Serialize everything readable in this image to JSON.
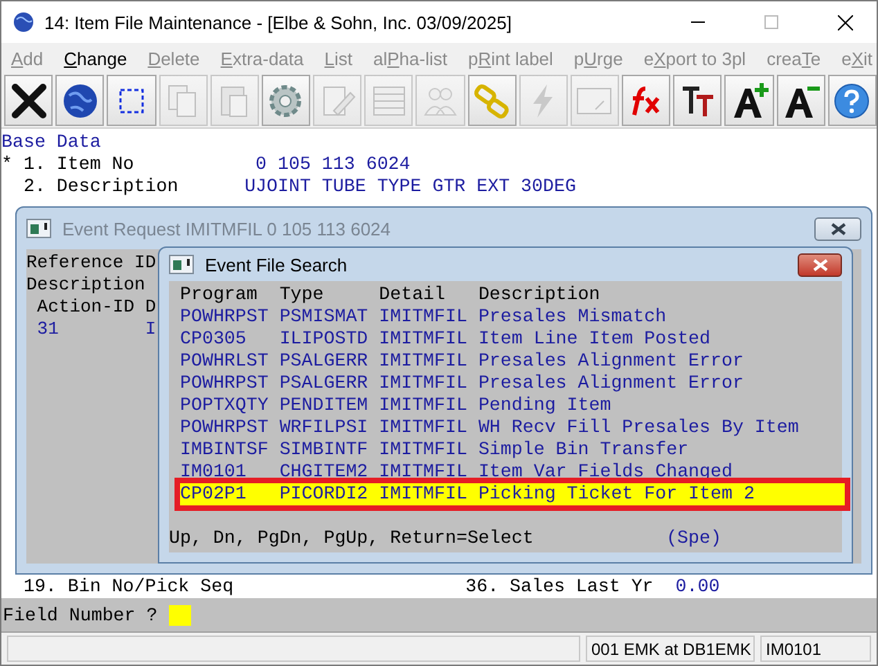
{
  "window": {
    "title": "14: Item File Maintenance - [Elbe & Sohn, Inc. 03/09/2025]"
  },
  "menu": [
    {
      "key": "A",
      "after": "dd",
      "disabled": true
    },
    {
      "key": "C",
      "after": "hange",
      "disabled": false
    },
    {
      "key": "D",
      "after": "elete",
      "disabled": true
    },
    {
      "key": "E",
      "after": "xtra-data",
      "disabled": true
    },
    {
      "key": "L",
      "after": "ist",
      "disabled": true
    },
    {
      "before": "al",
      "key": "P",
      "after": "ha-list",
      "disabled": true
    },
    {
      "before": "p",
      "key": "R",
      "after": "int label",
      "disabled": true
    },
    {
      "before": "p",
      "key": "U",
      "after": "rge",
      "disabled": true
    },
    {
      "before": "e",
      "key": "X",
      "after": "port to 3pl",
      "disabled": true
    },
    {
      "before": "crea",
      "key": "T",
      "after": "e",
      "disabled": true
    },
    {
      "before": "e",
      "key": "X",
      "after": "it",
      "disabled": true
    }
  ],
  "toolbar": [
    {
      "kind": "close",
      "disabled": false
    },
    {
      "kind": "globe",
      "disabled": false
    },
    {
      "kind": "select",
      "disabled": false
    },
    {
      "kind": "copy",
      "disabled": true
    },
    {
      "kind": "paste",
      "disabled": true
    },
    {
      "kind": "gear",
      "disabled": false
    },
    {
      "kind": "edit",
      "disabled": true
    },
    {
      "kind": "table",
      "disabled": true
    },
    {
      "kind": "people",
      "disabled": true
    },
    {
      "kind": "chain",
      "disabled": false
    },
    {
      "kind": "bolt",
      "disabled": true
    },
    {
      "kind": "window",
      "disabled": true
    },
    {
      "kind": "fx",
      "disabled": false
    },
    {
      "kind": "font",
      "disabled": false
    },
    {
      "kind": "grow",
      "disabled": false
    },
    {
      "kind": "shrink",
      "disabled": false
    },
    {
      "kind": "help",
      "disabled": false
    }
  ],
  "form": {
    "section": "Base Data",
    "fields": [
      {
        "marker": "*",
        "number": "1.",
        "label": "Item No",
        "value": " 0 105 113 6024"
      },
      {
        "number": "2.",
        "label": "Description",
        "value": "UJOINT TUBE TYPE GTR EXT 30DEG"
      }
    ],
    "bottom_row": {
      "left": {
        "number": "19.",
        "label": "Bin No/Pick Seq"
      },
      "right": {
        "number": "36.",
        "label": "Sales Last Yr",
        "value": "0.00"
      }
    }
  },
  "event_request": {
    "title": "Event Request IMITMFIL  0 105 113 6024",
    "lines": [
      "Reference ID",
      "Description"
    ],
    "header": " Action-ID D",
    "row": {
      "action_id": "31",
      "column_2": "I"
    }
  },
  "event_search": {
    "title": "Event File Search",
    "columns": [
      "Program",
      "Type",
      "Detail",
      "Description"
    ],
    "rows": [
      {
        "cells": [
          "POWHRPST",
          "PSMISMAT",
          "IMITMFIL",
          "Presales Mismatch"
        ],
        "selected": false
      },
      {
        "cells": [
          "CP0305",
          "ILIPOSTD",
          "IMITMFIL",
          "Item Line Item Posted"
        ],
        "selected": false
      },
      {
        "cells": [
          "POWHRLST",
          "PSALGERR",
          "IMITMFIL",
          "Presales Alignment Error"
        ],
        "selected": false
      },
      {
        "cells": [
          "POWHRPST",
          "PSALGERR",
          "IMITMFIL",
          "Presales Alignment Error"
        ],
        "selected": false
      },
      {
        "cells": [
          "POPTXQTY",
          "PENDITEM",
          "IMITMFIL",
          "Pending Item"
        ],
        "selected": false
      },
      {
        "cells": [
          "POWHRPST",
          "WRFILPSI",
          "IMITMFIL",
          "WH Recv Fill Presales By Item"
        ],
        "selected": false
      },
      {
        "cells": [
          "IMBINTSF",
          "SIMBINTF",
          "IMITMFIL",
          "Simple Bin Transfer"
        ],
        "selected": false
      },
      {
        "cells": [
          "IM0101",
          "CHGITEM2",
          "IMITMFIL",
          "Item Var Fields Changed"
        ],
        "selected": false
      },
      {
        "cells": [
          "CP02P1",
          "PICORDI2",
          "IMITMFIL",
          "Picking Ticket For Item 2"
        ],
        "selected": true
      }
    ],
    "hint": "Up, Dn, PgDn, PgUp, Return=Select",
    "mode": "(Spe)"
  },
  "prompt": {
    "label": "Field Number ?"
  },
  "status_bar": [
    "001 EMK at DB1EMK",
    "IM0101"
  ]
}
